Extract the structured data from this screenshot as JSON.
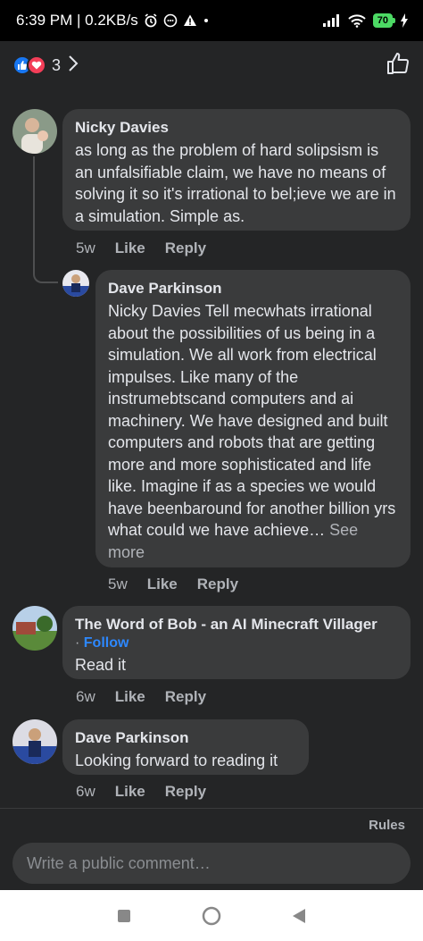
{
  "status_bar": {
    "time_speed": "6:39 PM | 0.2KB/s",
    "battery": "70"
  },
  "header": {
    "reaction_count": "3"
  },
  "comments": [
    {
      "author": "Nicky Davies",
      "text": "as long as the problem of hard solipsism is an unfalsifiable claim, we have no means of solving it so it's irrational to bel;ieve we are in a simulation. Simple as.",
      "time": "5w",
      "like": "Like",
      "reply": "Reply"
    },
    {
      "author": "Dave Parkinson",
      "text": "Nicky Davies Tell mecwhats irrational about the possibilities of us being in a simulation. We all work  from electrical impulses. Like many of the instrumebtscand computers and ai machinery.  We have designed and built computers and robots that are getting more and more sophisticated and life like. Imagine if as a species we would have beenbaround for another billion yrs what could we have achieve…",
      "see_more": "See more",
      "time": "5w",
      "like": "Like",
      "reply": "Reply"
    },
    {
      "author": "The Word of Bob - an AI Minecraft Villager",
      "follow_prefix": "·",
      "follow": "Follow",
      "text": "Read it",
      "time": "6w",
      "like": "Like",
      "reply": "Reply"
    },
    {
      "author": "Dave Parkinson",
      "text": "Looking forward to reading it",
      "time": "6w",
      "like": "Like",
      "reply": "Reply"
    }
  ],
  "footer": {
    "rules": "Rules",
    "input_placeholder": "Write a public comment…"
  },
  "colors": {
    "background": "#242526",
    "bubble": "#3a3b3c",
    "link": "#2d88ff",
    "like_reaction": "#1877f2",
    "love_reaction": "#f33e58"
  }
}
